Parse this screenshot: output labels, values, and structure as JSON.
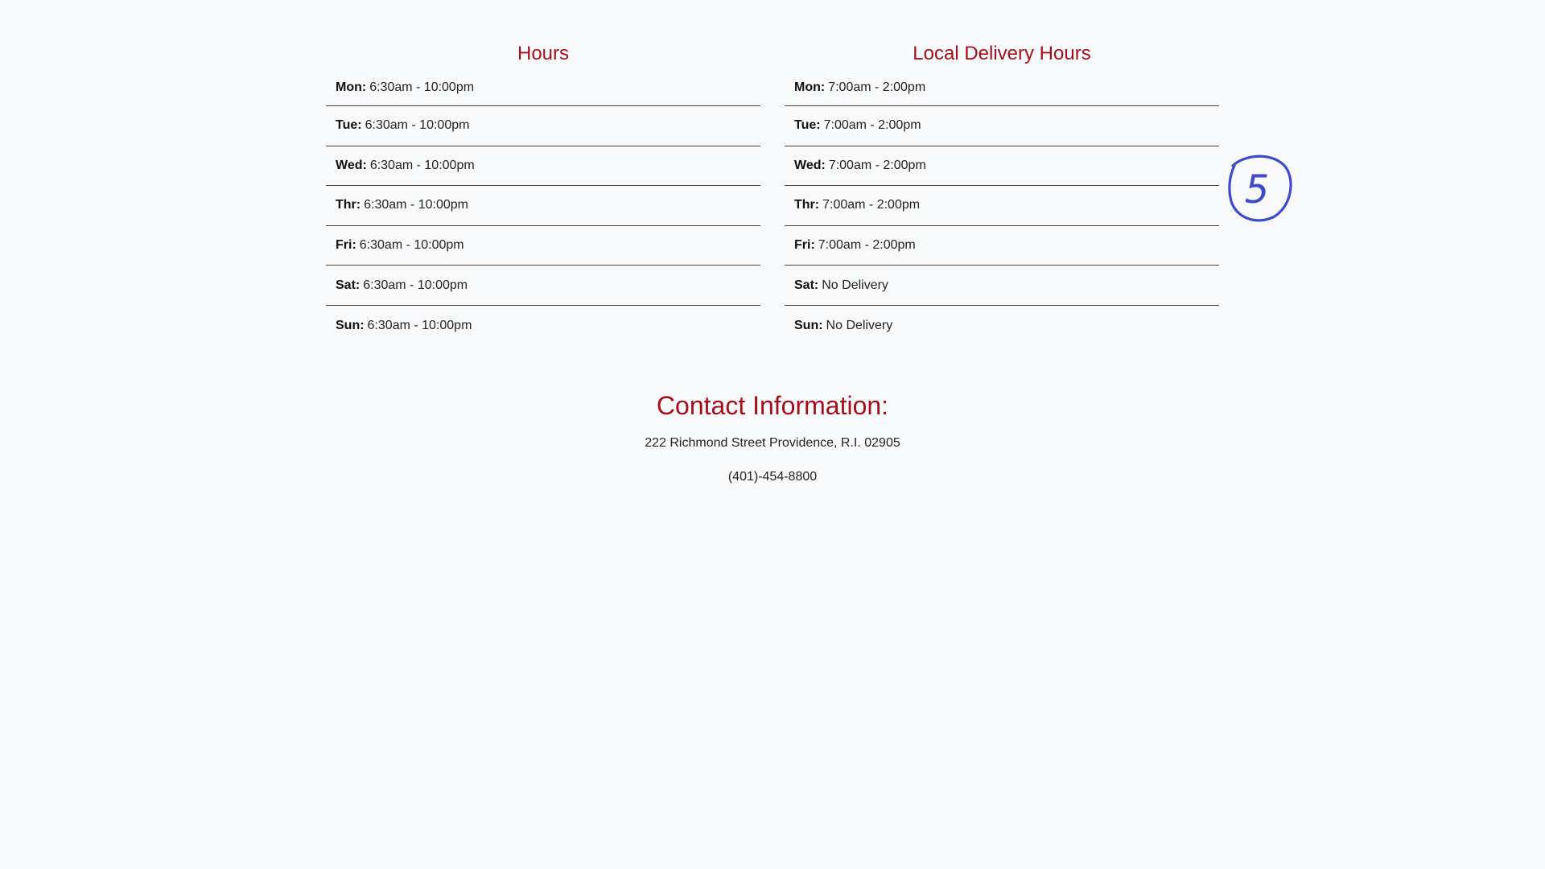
{
  "hours": {
    "title": "Hours",
    "rows": [
      {
        "day": "Mon:",
        "time": "6:30am - 10:00pm"
      },
      {
        "day": "Tue:",
        "time": "6:30am - 10:00pm"
      },
      {
        "day": "Wed:",
        "time": "6:30am - 10:00pm"
      },
      {
        "day": "Thr:",
        "time": "6:30am - 10:00pm"
      },
      {
        "day": "Fri:",
        "time": "6:30am - 10:00pm"
      },
      {
        "day": "Sat:",
        "time": "6:30am - 10:00pm"
      },
      {
        "day": "Sun:",
        "time": "6:30am - 10:00pm"
      }
    ]
  },
  "delivery": {
    "title": "Local Delivery Hours",
    "rows": [
      {
        "day": "Mon:",
        "time": "7:00am - 2:00pm"
      },
      {
        "day": "Tue:",
        "time": "7:00am - 2:00pm"
      },
      {
        "day": "Wed:",
        "time": "7:00am - 2:00pm"
      },
      {
        "day": "Thr:",
        "time": "7:00am - 2:00pm"
      },
      {
        "day": "Fri:",
        "time": "7:00am - 2:00pm"
      },
      {
        "day": "Sat:",
        "time": "No Delivery"
      },
      {
        "day": "Sun:",
        "time": "No Delivery"
      }
    ]
  },
  "contact": {
    "title": "Contact Information:",
    "address": "222 Richmond Street Providence, R.I. 02905",
    "phone": "(401)-454-8800"
  },
  "annotation": {
    "label": "5",
    "color": "#3f4cc7"
  },
  "colors": {
    "accent": "#a50f1a",
    "background": "#f8f9fb"
  }
}
